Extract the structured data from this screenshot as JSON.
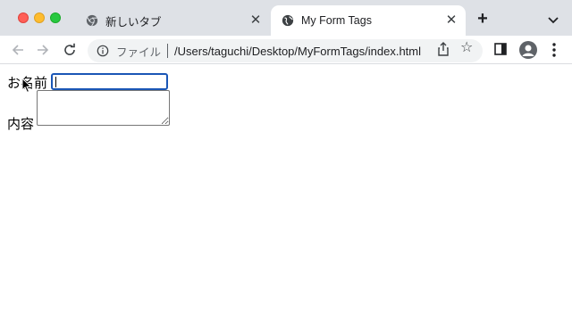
{
  "browser": {
    "tabs": [
      {
        "title": "新しいタブ",
        "icon": "chrome-icon",
        "active": false
      },
      {
        "title": "My Form Tags",
        "icon": "globe-icon",
        "active": true
      }
    ],
    "new_tab_symbol": "+",
    "close_symbol": "✕",
    "address": {
      "scheme_label": "ファイル",
      "url": "/Users/taguchi/Desktop/MyFormTags/index.html"
    },
    "star_symbol": "☆"
  },
  "form": {
    "name_label": "お名前",
    "name_value": "",
    "content_label": "内容",
    "content_value": ""
  },
  "colors": {
    "tabstrip": "#dee1e6",
    "focus_ring": "#1a56b6"
  }
}
